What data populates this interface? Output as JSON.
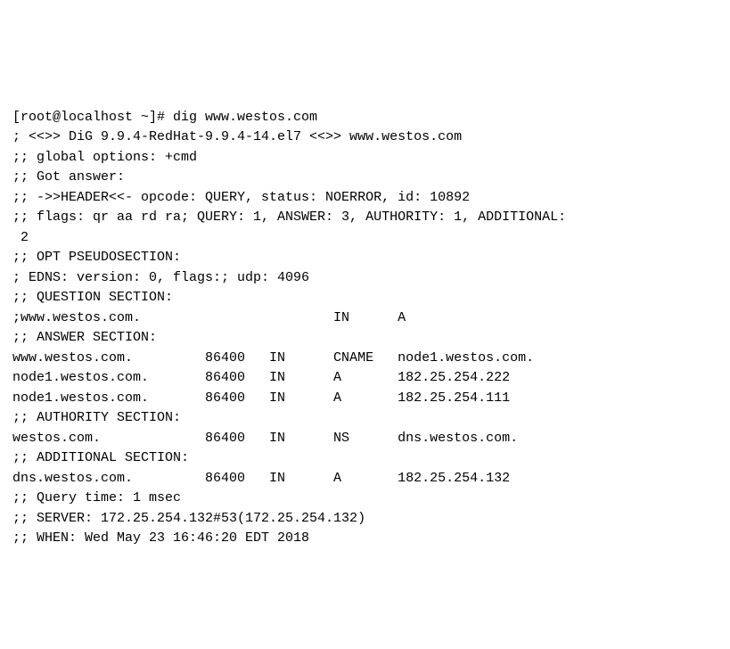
{
  "prompt": "[root@localhost ~]# ",
  "command": "dig www.westos.com",
  "header_line": "; <<>> DiG 9.9.4-RedHat-9.9.4-14.el7 <<>> www.westos.com",
  "global_options": ";; global options: +cmd",
  "got_answer": ";; Got answer:",
  "header_opcode": ";; ->>HEADER<<- opcode: QUERY, status: NOERROR, id: 10892",
  "flags_line1": ";; flags: qr aa rd ra; QUERY: 1, ANSWER: 3, AUTHORITY: 1, ADDITIONAL:",
  "flags_line2": " 2",
  "opt_pseudo": ";; OPT PSEUDOSECTION:",
  "edns_line": "; EDNS: version: 0, flags:; udp: 4096",
  "question_header": ";; QUESTION SECTION:",
  "question_row": ";www.westos.com.                        IN      A",
  "answer_header": ";; ANSWER SECTION:",
  "answer_row1": "www.westos.com.         86400   IN      CNAME   node1.westos.com.",
  "answer_row2": "node1.westos.com.       86400   IN      A       182.25.254.222",
  "answer_row3": "node1.westos.com.       86400   IN      A       182.25.254.111",
  "authority_header": ";; AUTHORITY SECTION:",
  "authority_row": "westos.com.             86400   IN      NS      dns.westos.com.",
  "additional_header": ";; ADDITIONAL SECTION:",
  "additional_row": "dns.westos.com.         86400   IN      A       182.25.254.132",
  "query_time": ";; Query time: 1 msec",
  "server_line": ";; SERVER: 172.25.254.132#53(172.25.254.132)",
  "when_line": ";; WHEN: Wed May 23 16:46:20 EDT 2018"
}
